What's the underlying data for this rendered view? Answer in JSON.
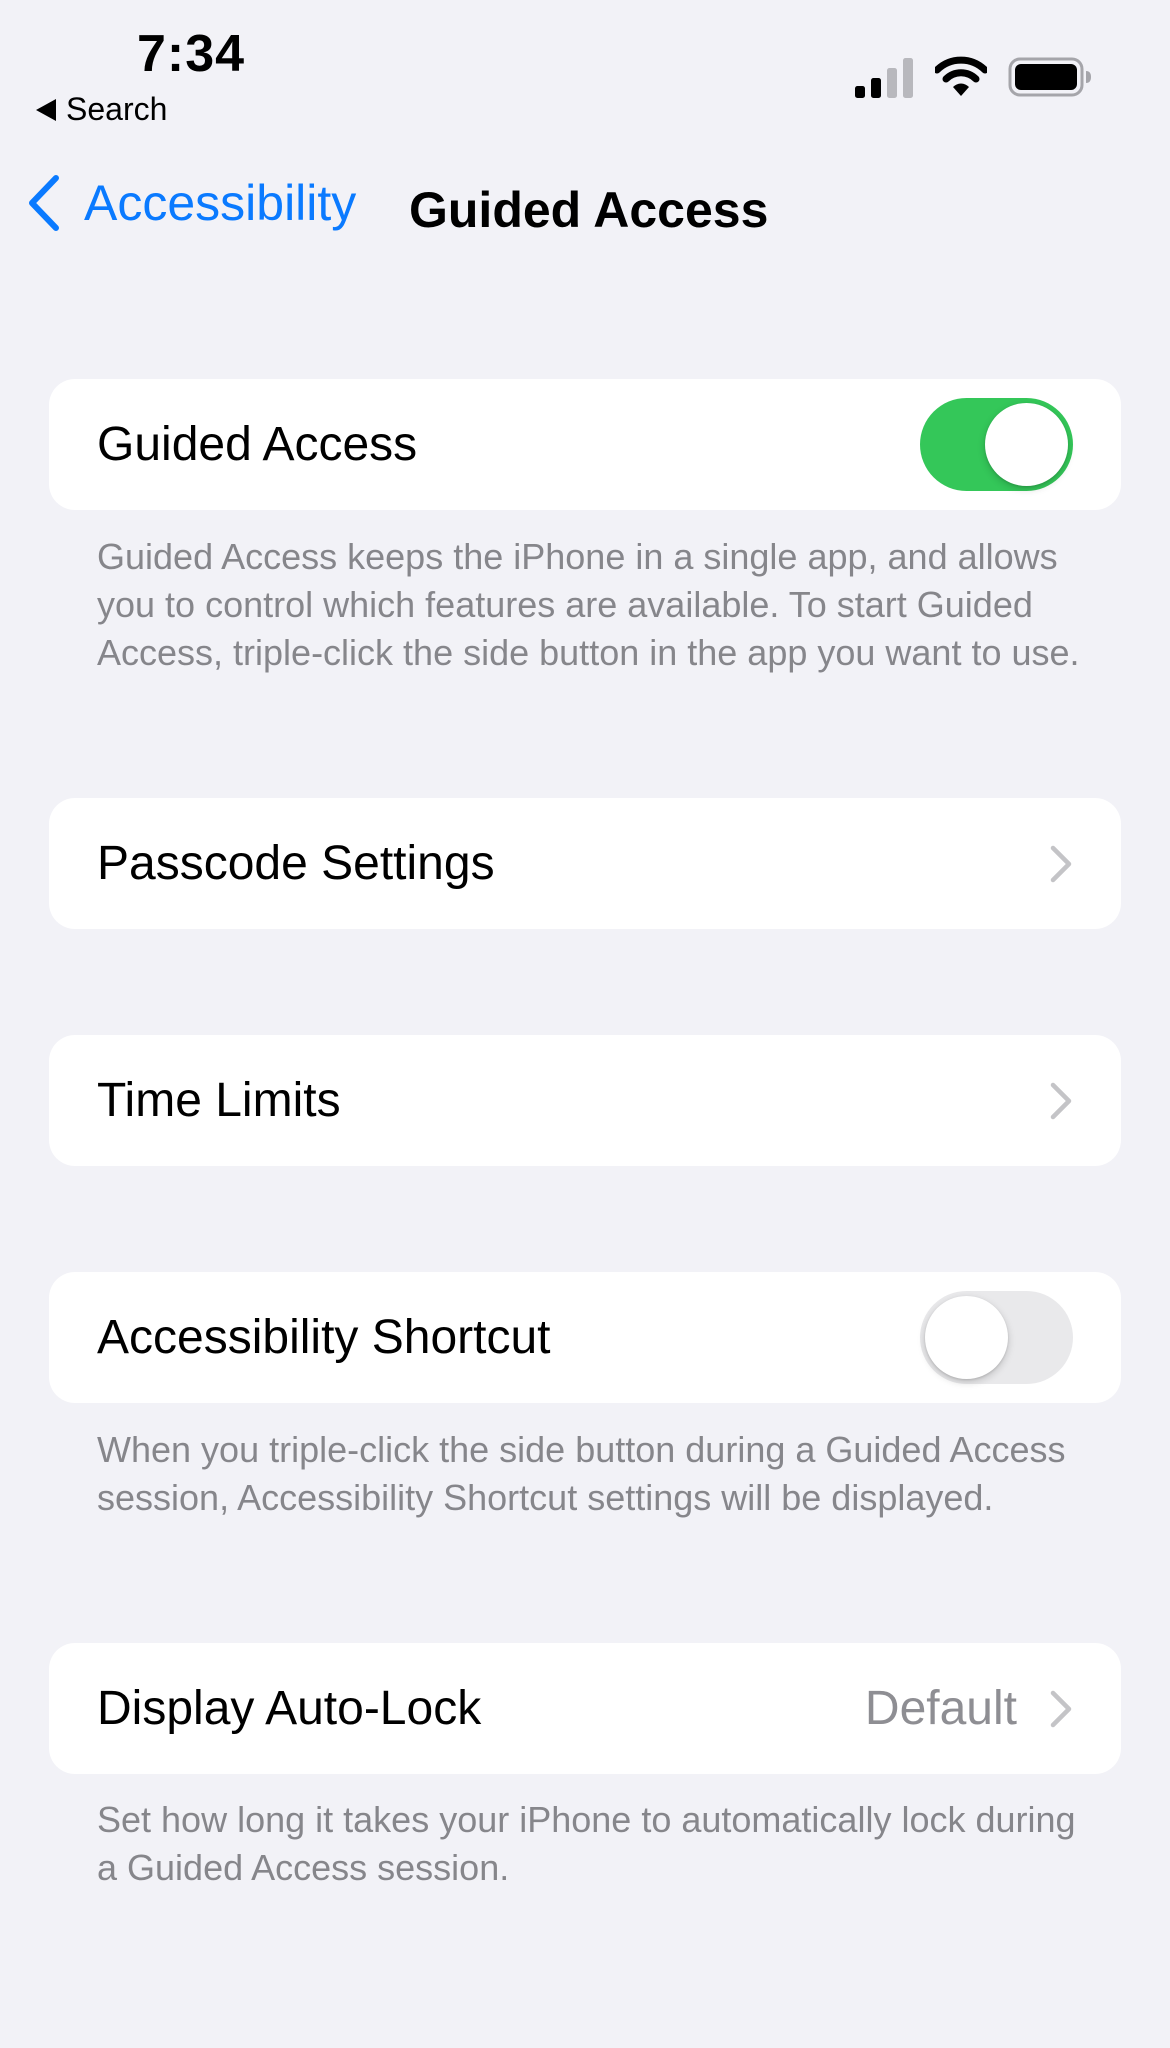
{
  "status_bar": {
    "time": "7:34",
    "back_app": "Search"
  },
  "nav": {
    "back_label": "Accessibility",
    "title": "Guided Access"
  },
  "colors": {
    "accent": "#0a7aff",
    "toggle_on": "#34c759",
    "toggle_off": "#e9e9eb",
    "background": "#f2f2f7"
  },
  "sections": {
    "guided_access": {
      "label": "Guided Access",
      "toggle_on": true,
      "footer": "Guided Access keeps the iPhone in a single app, and allows you to control which features are available. To start Guided Access, triple-click the side button in the app you want to use."
    },
    "passcode_settings": {
      "label": "Passcode Settings"
    },
    "time_limits": {
      "label": "Time Limits"
    },
    "accessibility_shortcut": {
      "label": "Accessibility Shortcut",
      "toggle_on": false,
      "footer": "When you triple-click the side button during a Guided Access session, Accessibility Shortcut settings will be displayed."
    },
    "display_auto_lock": {
      "label": "Display Auto-Lock",
      "value": "Default",
      "footer": "Set how long it takes your iPhone to automatically lock during a Guided Access session."
    }
  }
}
